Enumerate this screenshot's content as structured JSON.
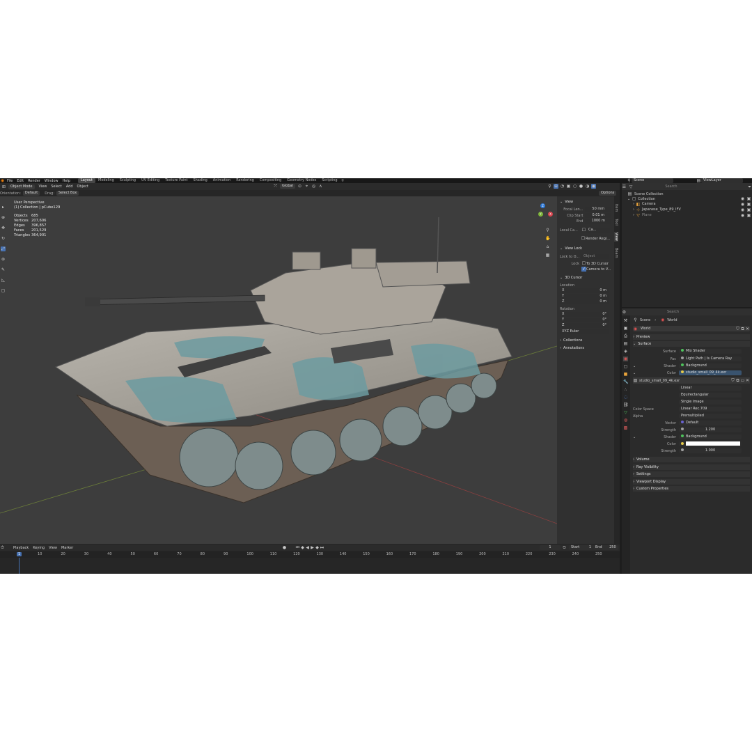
{
  "topbar": {
    "menus": [
      "File",
      "Edit",
      "Render",
      "Window",
      "Help"
    ],
    "workspaces": [
      "Layout",
      "Modeling",
      "Sculpting",
      "UV Editing",
      "Texture Paint",
      "Shading",
      "Animation",
      "Rendering",
      "Compositing",
      "Geometry Nodes",
      "Scripting"
    ],
    "active_workspace": "Layout",
    "scene": "Scene",
    "view_layer": "ViewLayer"
  },
  "header": {
    "mode": "Object Mode",
    "menus": [
      "View",
      "Select",
      "Add",
      "Object"
    ],
    "transform": "Global",
    "options": "Options"
  },
  "tool_settings": {
    "orientation_label": "Orientation:",
    "orientation": "Default",
    "drag_label": "Drag:",
    "drag": "Select Box"
  },
  "viewport": {
    "perspective": "User Perspective",
    "collection": "(1) Collection | pCube129",
    "stats": [
      {
        "label": "Objects",
        "value": "685"
      },
      {
        "label": "Vertices",
        "value": "207,606"
      },
      {
        "label": "Edges",
        "value": "396,857"
      },
      {
        "label": "Faces",
        "value": "201,529"
      },
      {
        "label": "Triangles",
        "value": "364,901"
      }
    ],
    "axes": {
      "x": "X",
      "y": "Y",
      "z": "Z"
    }
  },
  "npanel": {
    "tabs": [
      "Item",
      "Tool",
      "View",
      "Beam"
    ],
    "view_title": "View",
    "focal_label": "Focal Len...",
    "focal_value": "50 mm",
    "clip_label": "Clip Start",
    "clip_start": "0.01 m",
    "end_label": "End",
    "clip_end": "1000 m",
    "local_label": "Local Ca...",
    "local_value": "Ca...",
    "render_reg": "Render Regi...",
    "viewlock_title": "View Lock",
    "lock_to_label": "Lock to O...",
    "lock_object": "Object",
    "lock_label": "Lock",
    "to_cursor": "To 3D Cursor",
    "camera_to_view": "Camera to V...",
    "cursor_title": "3D Cursor",
    "location_label": "Location",
    "location": [
      {
        "axis": "X",
        "value": "0 m"
      },
      {
        "axis": "Y",
        "value": "0 m"
      },
      {
        "axis": "Z",
        "value": "0 m"
      }
    ],
    "rotation_label": "Rotation",
    "rotation": [
      {
        "axis": "X",
        "value": "0°"
      },
      {
        "axis": "Y",
        "value": "0°"
      },
      {
        "axis": "Z",
        "value": "0°"
      }
    ],
    "rotation_mode": "XYZ Euler",
    "collections": "Collections",
    "annotations": "Annotations"
  },
  "outliner": {
    "search_placeholder": "Search",
    "scene_collection": "Scene Collection",
    "collection": "Collection",
    "items": [
      "Camera",
      "Japanese_Type_89_IFV",
      "Plane"
    ]
  },
  "properties": {
    "search_placeholder": "Search",
    "breadcrumb": [
      "Scene",
      "World"
    ],
    "world_name": "World",
    "preview": "Preview",
    "surface_section": "Surface",
    "surface_label": "Surface",
    "surface_value": "Mix Shader",
    "fac_label": "Fac",
    "fac_value": "Light Path | Is Camera Ray",
    "shader_label": "Shader",
    "shader1_value": "Background",
    "color_label": "Color",
    "color_value": "studio_small_09_4k.exr",
    "image_name": "studio_small_09_4k.exr",
    "interp": "Linear",
    "projection": "Equirectangular",
    "source": "Single Image",
    "colorspace_label": "Color Space",
    "colorspace": "Linear Rec.709",
    "alpha_label": "Alpha",
    "alpha": "Premultiplied",
    "vector_label": "Vector",
    "vector": "Default",
    "strength_label": "Strength",
    "strength1": "1.200",
    "shader2_value": "Background",
    "strength2": "1.000",
    "sections": [
      "Volume",
      "Ray Visibility",
      "Settings",
      "Viewport Display",
      "Custom Properties"
    ]
  },
  "timeline": {
    "menus": [
      "Playback",
      "Keying",
      "View",
      "Marker"
    ],
    "current_frame": "1",
    "start_label": "Start",
    "start": "1",
    "end_label": "End",
    "end": "250",
    "ticks": [
      "1",
      "10",
      "20",
      "30",
      "40",
      "50",
      "60",
      "70",
      "80",
      "90",
      "100",
      "110",
      "120",
      "130",
      "140",
      "150",
      "160",
      "170",
      "180",
      "190",
      "200",
      "210",
      "220",
      "230",
      "240",
      "250"
    ]
  },
  "colors": {
    "accent": "#4772b3",
    "bg": "#1d1d1d",
    "panel": "#303030",
    "viewport": "#3d3d3d"
  }
}
